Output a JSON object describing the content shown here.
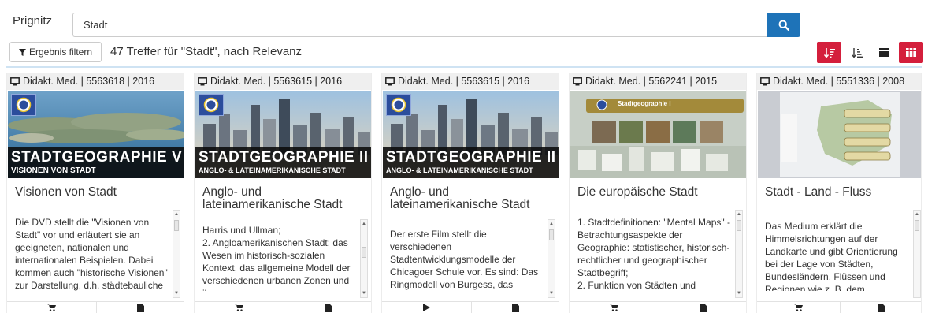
{
  "search": {
    "source_label": "Prignitz",
    "query": "Stadt"
  },
  "results": {
    "filter_label": "Ergebnis filtern",
    "count_text": "47 Treffer für \"Stadt\", nach Relevanz"
  },
  "colors": {
    "primary_blue": "#1e73b8",
    "accent_red": "#d41f3c"
  },
  "cards": [
    {
      "meta": "Didakt. Med. | 5563618 | 2016",
      "image_title": "STADTGEOGRAPHIE V",
      "image_subtitle": "VISIONEN VON STADT",
      "title": "Visionen von Stadt",
      "description": "Die DVD stellt die \"Visionen von Stadt\" vor und erläutert sie an geeigneten, nationalen und internationalen Beispielen. Dabei kommen auch \"historische Visionen\" zur Darstellung, d.h. städtebauliche",
      "foot_icons": [
        "cart-icon",
        "document-icon"
      ]
    },
    {
      "meta": "Didakt. Med. | 5563615 | 2016",
      "image_title": "STADTGEOGRAPHIE II",
      "image_subtitle": "ANGLO- & LATEINAMERIKANISCHE STADT",
      "title": "Anglo- und lateinamerikanische Stadt",
      "description": "Harris und Ullman;\n2. Angloamerikanischen Stadt: das Wesen im historisch-sozialen Kontext, das allgemeine Modell der verschiedenen urbanen Zonen und ihre",
      "foot_icons": [
        "cart-icon",
        "document-icon"
      ]
    },
    {
      "meta": "Didakt. Med. | 5563615 | 2016",
      "image_title": "STADTGEOGRAPHIE II",
      "image_subtitle": "ANGLO- & LATEINAMERIKANISCHE STADT",
      "title": "Anglo- und lateinamerikanische Stadt",
      "description": "Der erste Film stellt die verschiedenen Stadtentwicklungsmodelle der Chicagoer Schule vor. Es sind: Das Ringmodell von Burgess, das Sektorenmodell von Hoyt",
      "foot_icons": [
        "play-icon",
        "document-icon"
      ]
    },
    {
      "meta": "Didakt. Med. | 5562241 | 2015",
      "image_banner": "Stadtgeographie I",
      "title": "Die europäische Stadt",
      "description": "1. Stadtdefinitionen: \"Mental Maps\" - Betrachtungsaspekte der Geographie: statistischer, historisch-rechtlicher und geographischer Stadtbegriff;\n2. Funktion von Städten und Stadtteilebeschreibung der",
      "foot_icons": [
        "cart-icon",
        "document-icon"
      ]
    },
    {
      "meta": "Didakt. Med. | 5551336 | 2008",
      "title": "Stadt - Land - Fluss",
      "description": "Das Medium erklärt die Himmelsrichtungen auf der Landkarte und gibt Orientierung bei der Lage von Städten, Bundesländern, Flüssen und Regionen wie z. B. dem",
      "foot_icons": [
        "cart-icon",
        "document-icon"
      ]
    }
  ]
}
